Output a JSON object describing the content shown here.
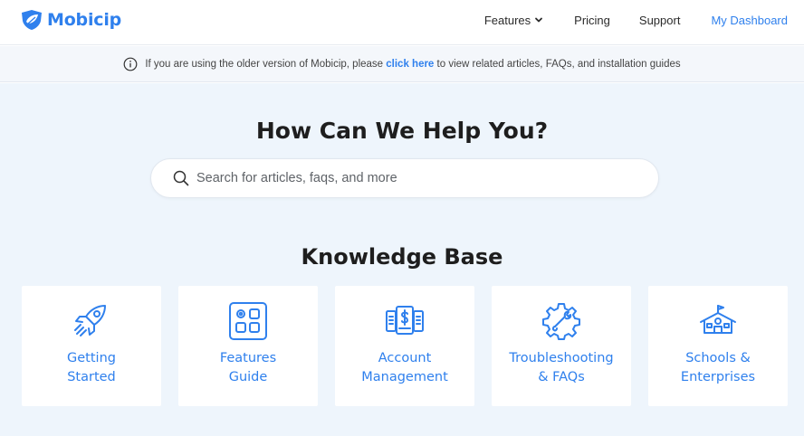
{
  "colors": {
    "accent": "#2f80ed",
    "hero_bg": "#eef5fc",
    "notice_bg": "#f4f7fb"
  },
  "header": {
    "logo_icon": "shield-leaf-icon",
    "logo_text": "Mobicip",
    "nav": {
      "features": "Features",
      "pricing": "Pricing",
      "support": "Support",
      "dashboard": "My Dashboard"
    }
  },
  "notice": {
    "icon": "info-icon",
    "before": "If you are using the older version of Mobicip, please ",
    "link": "click here",
    "after": " to view related articles, FAQs, and installation guides"
  },
  "hero": {
    "title": "How Can We Help You?",
    "search_placeholder": "Search for articles, faqs, and more"
  },
  "knowledge_base": {
    "title": "Knowledge Base",
    "cards": [
      {
        "icon": "rocket-icon",
        "line1": "Getting",
        "line2": "Started"
      },
      {
        "icon": "features-grid-icon",
        "line1": "Features",
        "line2": "Guide"
      },
      {
        "icon": "account-money-icon",
        "line1": "Account",
        "line2": "Management"
      },
      {
        "icon": "gear-wrench-icon",
        "line1": "Troubleshooting",
        "line2": "& FAQs"
      },
      {
        "icon": "school-building-icon",
        "line1": "Schools &",
        "line2": "Enterprises"
      }
    ]
  }
}
